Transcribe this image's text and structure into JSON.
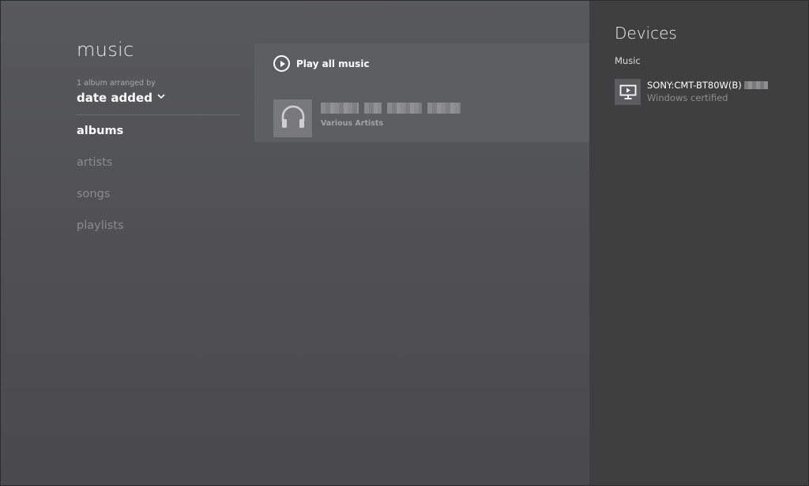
{
  "app": {
    "title": "music"
  },
  "sort": {
    "caption": "1 album arranged by",
    "selected": "date added"
  },
  "nav": {
    "items": [
      {
        "label": "albums",
        "active": true
      },
      {
        "label": "artists",
        "active": false
      },
      {
        "label": "songs",
        "active": false
      },
      {
        "label": "playlists",
        "active": false
      }
    ]
  },
  "content": {
    "play_all_label": "Play all music",
    "play_icon": "play-circle-icon",
    "album": {
      "artist": "Various Artists",
      "art_icon": "headphones-icon"
    }
  },
  "devices": {
    "title": "Devices",
    "section": "Music",
    "items": [
      {
        "name": "SONY:CMT-BT80W(B)",
        "status": "Windows certified",
        "icon": "monitor-play-icon"
      }
    ]
  },
  "colors": {
    "main_bg": "#545557",
    "panel_bg": "#5d5e60",
    "devices_bg": "#3f3f40",
    "text_primary": "#ffffff",
    "text_muted": "#8c8c8e"
  }
}
